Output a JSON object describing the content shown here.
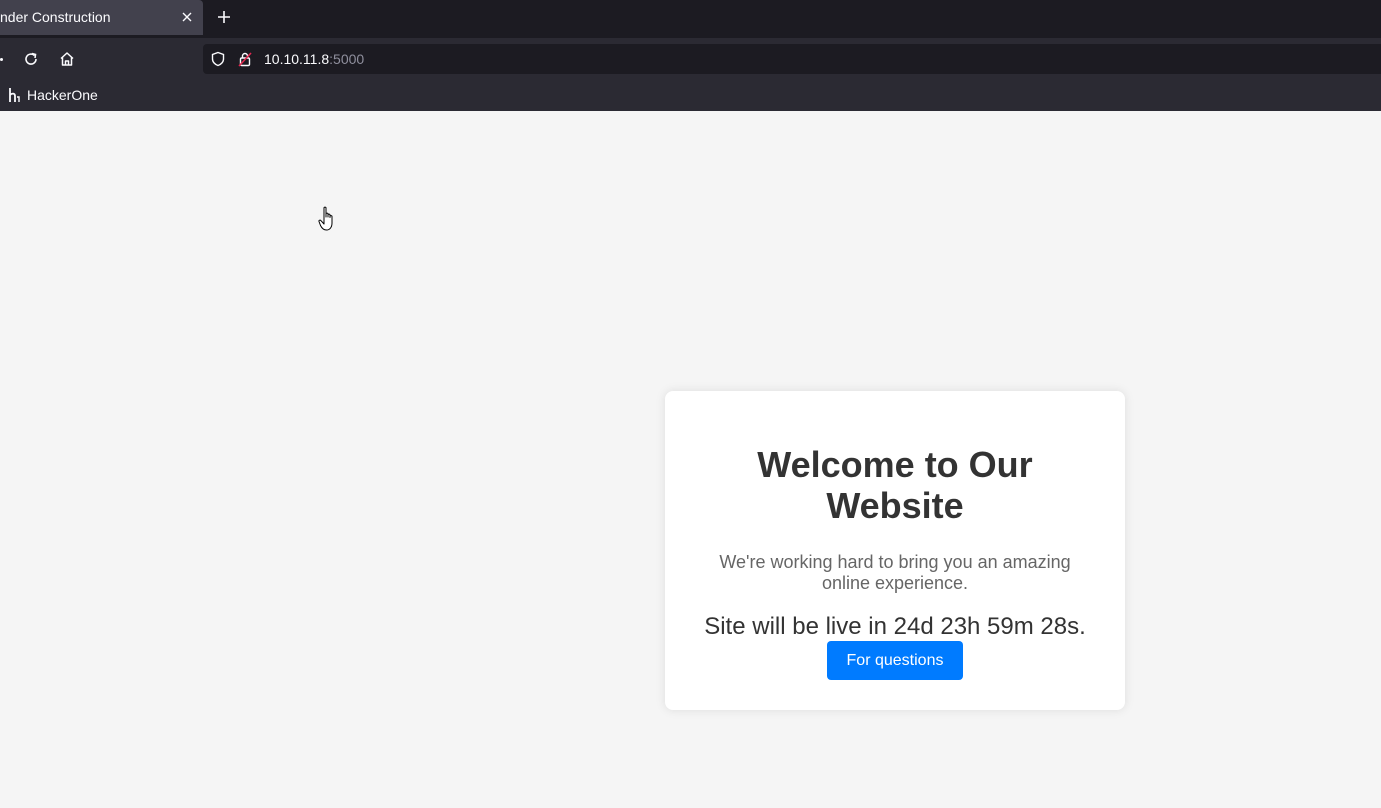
{
  "browser": {
    "tab": {
      "title": "nder Construction",
      "close_icon": "close-icon"
    },
    "new_tab_icon": "plus-icon",
    "nav": {
      "reload_icon": "reload-icon",
      "home_icon": "home-icon"
    },
    "url": {
      "host": "10.10.11.8",
      "port": ":5000",
      "shield_icon": "shield-icon",
      "lock_icon": "insecure-lock-icon"
    },
    "bookmarks": [
      {
        "label": "HackerOne",
        "icon": "h1-icon"
      }
    ]
  },
  "page": {
    "heading": "Welcome to Our Website",
    "subtitle": "We're working hard to bring you an amazing online experience.",
    "countdown": "Site will be live in 24d 23h 59m 28s.",
    "cta_label": "For questions",
    "colors": {
      "background": "#f5f5f5",
      "card": "#ffffff",
      "button": "#007bff",
      "heading": "#333333",
      "subtitle": "#666666"
    }
  }
}
